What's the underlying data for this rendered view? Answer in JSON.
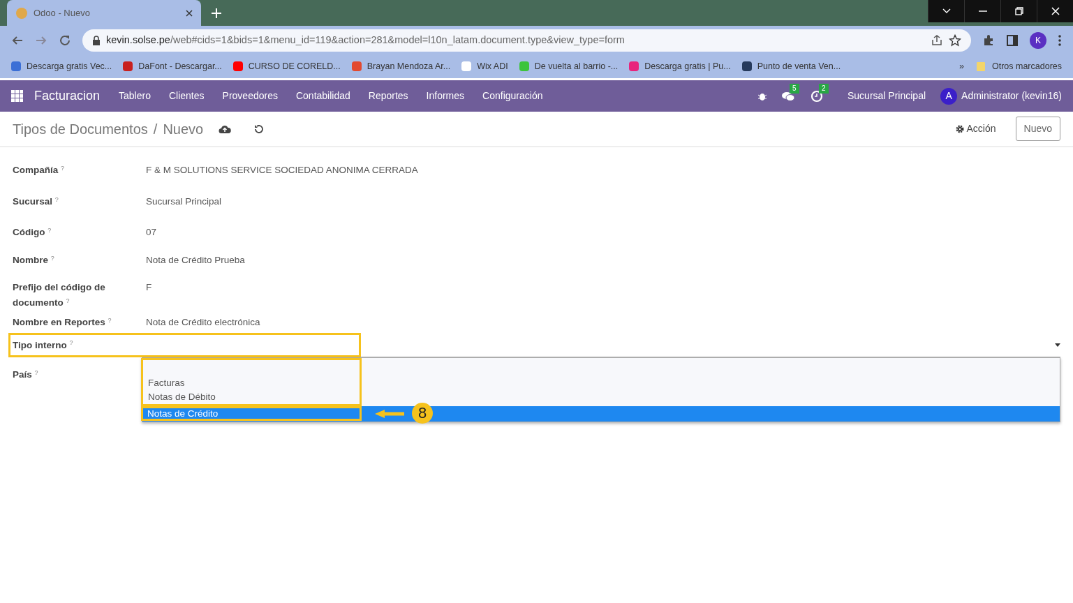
{
  "browser": {
    "tab_title": "Odoo - Nuevo",
    "url_host": "kevin.solse.pe",
    "url_path": "/web#cids=1&bids=1&menu_id=119&action=281&model=l10n_latam.document.type&view_type=form",
    "profile_initial": "K",
    "bookmarks": [
      {
        "label": "Descarga gratis Vec...",
        "color": "#3b6fd6"
      },
      {
        "label": "DaFont - Descargar...",
        "color": "#c8201e"
      },
      {
        "label": "CURSO DE CORELD...",
        "color": "#ff0000"
      },
      {
        "label": "Brayan Mendoza Ar...",
        "color": "#e2492f"
      },
      {
        "label": "Wix ADI",
        "color": "#ffffff"
      },
      {
        "label": "De vuelta al barrio -...",
        "color": "#3cc43c"
      },
      {
        "label": "Descarga gratis | Pu...",
        "color": "#e8247c"
      },
      {
        "label": "Punto de venta Ven...",
        "color": "#263a5c"
      }
    ],
    "more": "»",
    "other_bookmarks": "Otros marcadores"
  },
  "app": {
    "name": "Facturacion",
    "menu": [
      "Tablero",
      "Clientes",
      "Proveedores",
      "Contabilidad",
      "Reportes",
      "Informes",
      "Configuración"
    ],
    "messages_count": "5",
    "activities_count": "2",
    "branch": "Sucursal Principal",
    "user_initial": "A",
    "user": "Administrator (kevin16)"
  },
  "breadcrumb": {
    "parent": "Tipos de Documentos",
    "separator": "/",
    "current": "Nuevo"
  },
  "action_menu": "Acción",
  "new_button": "Nuevo",
  "fields": [
    {
      "label": "Compañía",
      "help": "?",
      "kind": "text",
      "value": "F & M SOLUTIONS SERVICE SOCIEDAD ANONIMA CERRADA"
    },
    {
      "label": "Sucursal",
      "help": "?",
      "kind": "text",
      "value": "Sucursal Principal"
    },
    {
      "label": "Código",
      "help": "?",
      "kind": "text",
      "value": "07"
    },
    {
      "label": "Nombre",
      "help": "?",
      "kind": "text",
      "value": "Nota de Crédito Prueba"
    },
    {
      "label": "Prefijo del código de documento",
      "help": "?",
      "kind": "text",
      "value": "F"
    },
    {
      "label": "Nombre en Reportes",
      "help": "?",
      "kind": "text",
      "value": "Nota de Crédito electrónica"
    },
    {
      "label": "Tipo interno",
      "help": "?",
      "kind": "select"
    },
    {
      "label": "País",
      "help": "?",
      "kind": "text"
    }
  ],
  "dropdown": {
    "options": [
      {
        "label": "Facturas",
        "selected": false
      },
      {
        "label": "Notas de Débito",
        "selected": false
      },
      {
        "label": "Notas de Crédito",
        "selected": true
      }
    ]
  },
  "annotation": {
    "step": "8"
  }
}
